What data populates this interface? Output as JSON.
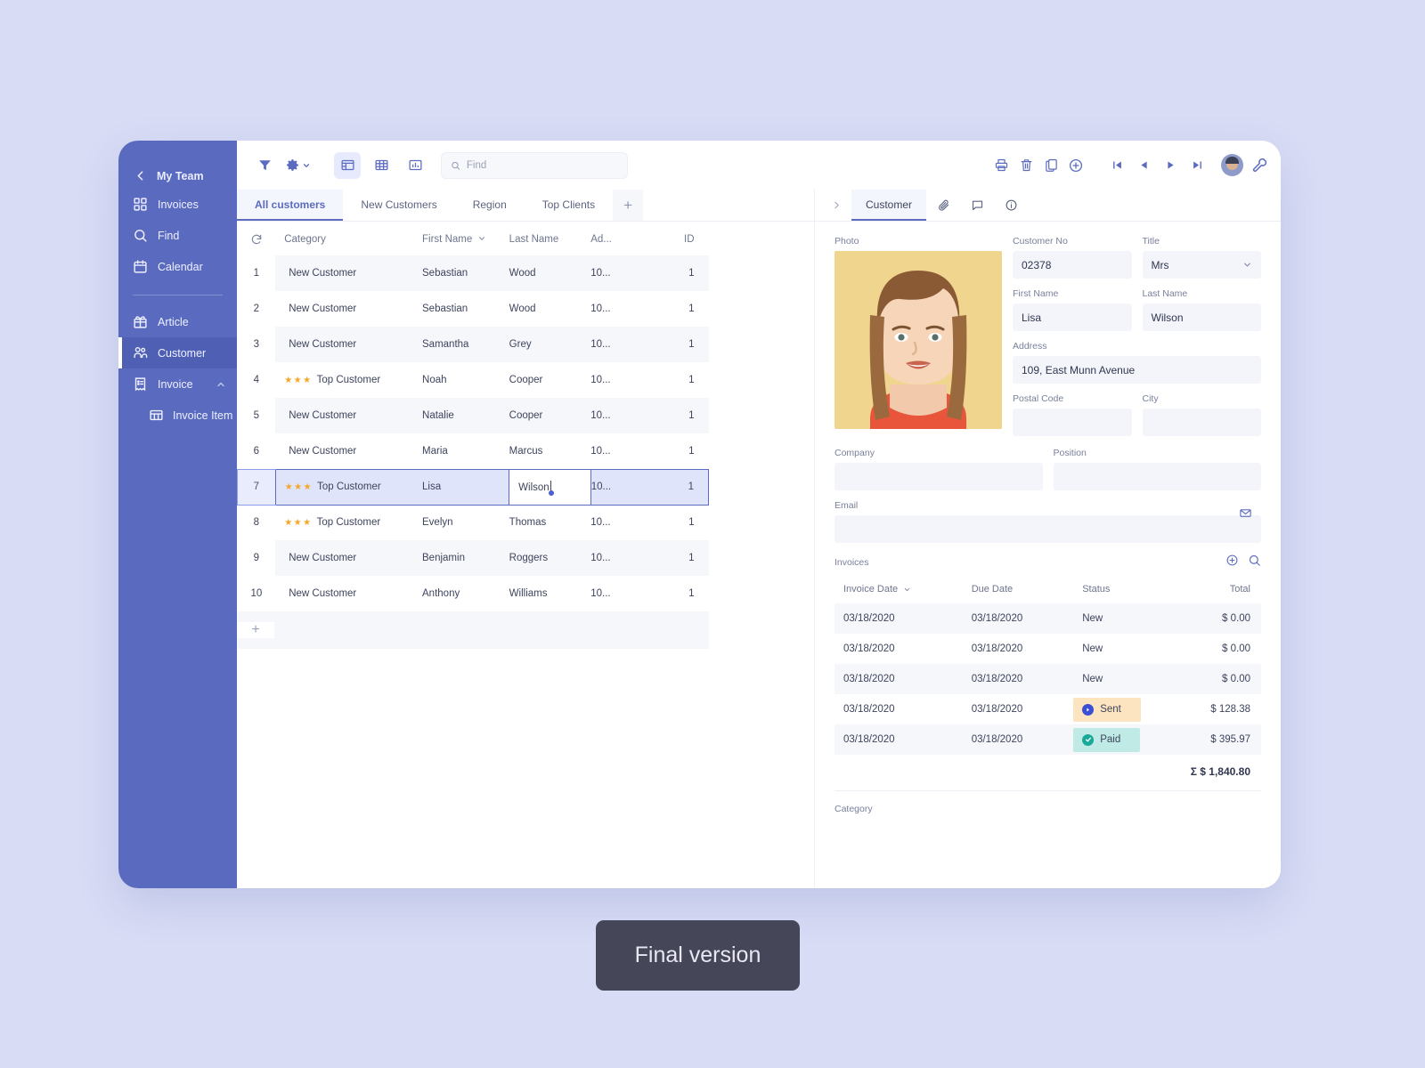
{
  "sidebar": {
    "back_label": "My Team",
    "items": [
      {
        "label": "Invoices",
        "icon": "grid-icon"
      },
      {
        "label": "Find",
        "icon": "search-icon"
      },
      {
        "label": "Calendar",
        "icon": "calendar-icon"
      }
    ],
    "items2": [
      {
        "label": "Article",
        "icon": "gift-icon"
      },
      {
        "label": "Customer",
        "icon": "users-icon"
      },
      {
        "label": "Invoice",
        "icon": "receipt-icon"
      }
    ],
    "sub_label": "Invoice Item",
    "accent": "#5a6bbf",
    "active_bg": "#4f60b4"
  },
  "toolbar": {
    "filter_icon": "filter-icon",
    "gear_icon": "gear-icon",
    "view_list_icon": "view-list-icon",
    "view_table_icon": "view-table-icon",
    "view_chart_icon": "view-chart-icon",
    "search_placeholder": "Find",
    "search_value": "",
    "print_icon": "print-icon",
    "delete_icon": "trash-icon",
    "copy_icon": "copy-icon",
    "add_icon": "plus-circle-icon",
    "nav_first_icon": "nav-first-icon",
    "nav_prev_icon": "nav-prev-icon",
    "nav_next_icon": "nav-next-icon",
    "nav_last_icon": "nav-last-icon",
    "avatar": "user-avatar",
    "settings_icon": "wrench-icon"
  },
  "tabs": {
    "items": [
      {
        "label": "All customers",
        "active": true
      },
      {
        "label": "New Customers",
        "active": false
      },
      {
        "label": "Region",
        "active": false
      },
      {
        "label": "Top Clients",
        "active": false
      }
    ],
    "add_label": "+"
  },
  "grid": {
    "refresh_icon": "refresh-icon",
    "columns": [
      "Category",
      "First Name",
      "Last Name",
      "Ad...",
      "ID"
    ],
    "sorted_column": "First Name",
    "rows": [
      {
        "n": "1",
        "category": "New Customer",
        "stars": "",
        "first": "Sebastian",
        "last": "Wood",
        "ad": "10...",
        "id": "1"
      },
      {
        "n": "2",
        "category": "New Customer",
        "stars": "",
        "first": "Sebastian",
        "last": "Wood",
        "ad": "10...",
        "id": "1"
      },
      {
        "n": "3",
        "category": "New Customer",
        "stars": "",
        "first": "Samantha",
        "last": "Grey",
        "ad": "10...",
        "id": "1"
      },
      {
        "n": "4",
        "category": "Top Customer",
        "stars": "★★★",
        "first": "Noah",
        "last": "Cooper",
        "ad": "10...",
        "id": "1"
      },
      {
        "n": "5",
        "category": "New Customer",
        "stars": "",
        "first": "Natalie",
        "last": "Cooper",
        "ad": "10...",
        "id": "1"
      },
      {
        "n": "6",
        "category": "New Customer",
        "stars": "",
        "first": "Maria",
        "last": "Marcus",
        "ad": "10...",
        "id": "1"
      },
      {
        "n": "7",
        "category": "Top Customer",
        "stars": "★★★",
        "first": "Lisa",
        "last": "Wilson",
        "ad": "10...",
        "id": "1",
        "selected": true
      },
      {
        "n": "8",
        "category": "Top Customer",
        "stars": "★★★",
        "first": "Evelyn",
        "last": "Thomas",
        "ad": "10...",
        "id": "1"
      },
      {
        "n": "9",
        "category": "New Customer",
        "stars": "",
        "first": "Benjamin",
        "last": "Roggers",
        "ad": "10...",
        "id": "1"
      },
      {
        "n": "10",
        "category": "New Customer",
        "stars": "",
        "first": "Anthony",
        "last": "Williams",
        "ad": "10...",
        "id": "1"
      }
    ],
    "add_row_label": "+",
    "star_color": "#f5a623",
    "selection_color": "#5b6bc0"
  },
  "detail": {
    "collapse_icon": "chevron-right-icon",
    "tab_label": "Customer",
    "attachment_icon": "paperclip-icon",
    "comment_icon": "comment-icon",
    "info_icon": "info-icon",
    "photo_label": "Photo",
    "fields": {
      "customer_no_label": "Customer No",
      "customer_no_value": "02378",
      "title_label": "Title",
      "title_value": "Mrs",
      "first_name_label": "First Name",
      "first_name_value": "Lisa",
      "last_name_label": "Last Name",
      "last_name_value": "Wilson",
      "address_label": "Address",
      "address_value": "109, East Munn Avenue",
      "postal_code_label": "Postal Code",
      "postal_code_value": "",
      "city_label": "City",
      "city_value": "",
      "company_label": "Company",
      "company_value": "",
      "position_label": "Position",
      "position_value": "",
      "email_label": "Email",
      "email_value": "",
      "email_icon": "envelope-icon"
    },
    "invoices": {
      "title": "Invoices",
      "add_icon": "plus-circle-icon",
      "search_icon": "search-icon",
      "columns": [
        "Invoice Date",
        "Due Date",
        "Status",
        "Total"
      ],
      "sorted_column": "Invoice Date",
      "rows": [
        {
          "date": "03/18/2020",
          "due": "03/18/2020",
          "status": "New",
          "badge": "",
          "total": "$ 0.00"
        },
        {
          "date": "03/18/2020",
          "due": "03/18/2020",
          "status": "New",
          "badge": "",
          "total": "$ 0.00"
        },
        {
          "date": "03/18/2020",
          "due": "03/18/2020",
          "status": "New",
          "badge": "",
          "total": "$ 0.00"
        },
        {
          "date": "03/18/2020",
          "due": "03/18/2020",
          "status": "Sent",
          "badge": "sent",
          "total": "$ 128.38"
        },
        {
          "date": "03/18/2020",
          "due": "03/18/2020",
          "status": "Paid",
          "badge": "paid",
          "total": "$ 395.97"
        }
      ],
      "sum_label": "Σ $ 1,840.80",
      "sent_color": "#fde4c0",
      "paid_color": "#bfeae5"
    },
    "category_label": "Category"
  },
  "final_button": {
    "label": "Final version",
    "bg": "#464659"
  }
}
